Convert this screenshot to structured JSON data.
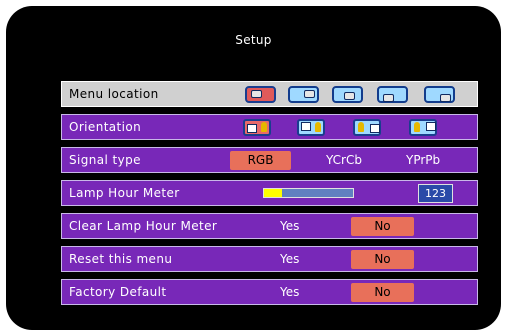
{
  "title": "Setup",
  "rows": {
    "menu_location": {
      "label": "Menu location",
      "icons": [
        "menu-position-top-left-icon",
        "menu-position-top-right-icon",
        "menu-position-center-icon",
        "menu-position-bottom-left-icon",
        "menu-position-bottom-right-icon"
      ]
    },
    "orientation": {
      "label": "Orientation",
      "icons": [
        "front-desktop-icon",
        "front-ceiling-icon",
        "rear-desktop-icon",
        "rear-ceiling-icon"
      ]
    },
    "signal_type": {
      "label": "Signal type",
      "options": [
        "RGB",
        "YCrCb",
        "YPrPb"
      ],
      "selected": "RGB"
    },
    "lamp_hour_meter": {
      "label": "Lamp Hour Meter",
      "value": "123",
      "level": 0.2
    },
    "clear_lamp": {
      "label": "Clear Lamp Hour Meter",
      "yes": "Yes",
      "no": "No"
    },
    "reset_menu": {
      "label": "Reset this menu",
      "yes": "Yes",
      "no": "No"
    },
    "factory_default": {
      "label": "Factory Default",
      "yes": "Yes",
      "no": "No"
    }
  },
  "colors": {
    "row_bg": "#7828b8",
    "highlight": "#e8705a",
    "selected_row": "#d0d0d0"
  }
}
